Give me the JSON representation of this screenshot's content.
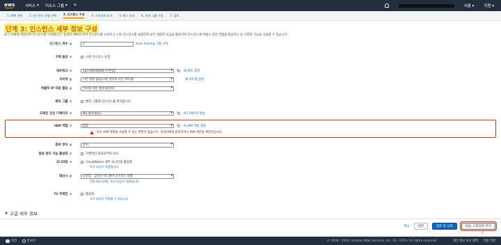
{
  "topnav": {
    "logo": "aws",
    "services": "서비스",
    "resource_groups": "리소스 그룹",
    "region": "서울",
    "support": "지원"
  },
  "wizard": {
    "steps": [
      "1. AMI 선택",
      "2. 인스턴스 유형 선택",
      "3. 인스턴스 구성",
      "4. 스토리지 추가",
      "5. 태그 추가",
      "6. 보안 그룹 구성",
      "7. 검토"
    ],
    "active_index": 2
  },
  "page": {
    "title": "단계 3: 인스턴스 세부 정보 구성",
    "description": "요구 사항에 적합하게 인스턴스를 구성합니다. 동일한 AMI의 여러 인스턴스를 시작하고 스팟 인스턴스를 요청하여 보다 저렴한 요금을 활용하며 인스턴스에 액세스 관리 역할을 할당하는 등 다양한 기능을 사용할 수 있습니다."
  },
  "form": {
    "instances": {
      "label": "인스턴스 개수",
      "value": "1",
      "link": "Auto Scaling 그룹 시작"
    },
    "purchase": {
      "label": "구매 옵션",
      "option": "스팟 인스턴스 요청"
    },
    "network": {
      "label": "네트워크",
      "value": "vpc-e60a8a66 (기본값)",
      "link": "새 VPC 생성"
    },
    "subnet": {
      "label": "서브넷",
      "value": "기본 설정 없음(가용 영역의 기본 서브넷)",
      "link": "새 서브넷 생성"
    },
    "public_ip": {
      "label": "퍼블릭 IP 자동 할당",
      "value": "서브넷 사용 설정(활성화)"
    },
    "placement": {
      "label": "배치 그룹",
      "option": "배치 그룹에 인스턴스를 추가합니다."
    },
    "domain": {
      "label": "도메인 조인 디렉터리",
      "value": "No directory",
      "link": "새 디렉터리 생성"
    },
    "iam": {
      "label": "IAM 역할",
      "value": "없음",
      "link": "새 IAM 역할 생성",
      "warning": "모든 IAM 역할을 사용할 수 있는 권한이 없습니다. 관리자에게 문의하거나 IAM 권한을 확인하십시오."
    },
    "shutdown": {
      "label": "종료 방식",
      "value": "중지"
    },
    "termination": {
      "label": "종료 방지 기능 활성화",
      "option": "우발적인 종료로부터 보호"
    },
    "monitoring": {
      "label": "모니터링",
      "option": "CloudWatch 세부 모니터링 활성화",
      "note": "추가 요금이 적용됩니다."
    },
    "tenancy": {
      "label": "테넌시",
      "value": "공유됨 - 공유된 하드웨어 인스턴스 실행",
      "note": "전용 테넌시에는 추가 요금이 적용됩니다."
    },
    "t2": {
      "label": "T2 무제한",
      "option": "활성화",
      "note": "추가 요금이 적용될 수 있습니다"
    }
  },
  "advanced": "고급 세부 정보",
  "buttons": {
    "cancel": "취소",
    "previous": "이전",
    "review": "검토 및 시작",
    "next": "다음: 스토리지 추가"
  },
  "footer": {
    "feedback": "의견",
    "language": "한국어",
    "copyright": "© 2008 - 2018, Amazon Web Services, Inc. 또는 자회사. All rights reserved.",
    "privacy": "개인 정보 보호 정책",
    "terms": "이용 약관"
  }
}
